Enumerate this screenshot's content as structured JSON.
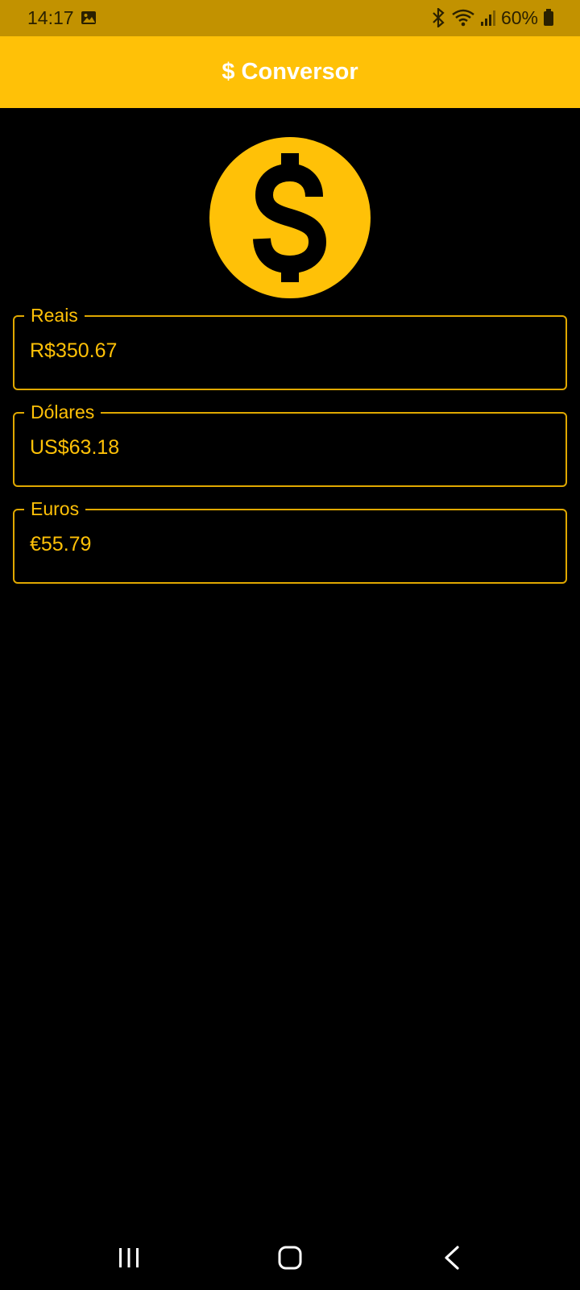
{
  "status_bar": {
    "time": "14:17",
    "battery_text": "60%",
    "icons": [
      "gallery-icon",
      "bluetooth-icon",
      "wifi-icon",
      "signal-icon",
      "battery-icon"
    ]
  },
  "app_bar": {
    "title": "$ Conversor",
    "background_color": "#ffc107"
  },
  "hero": {
    "icon": "dollar-coin-icon",
    "color": "#ffc107"
  },
  "fields": [
    {
      "label": "Reais",
      "value": "R$350.67"
    },
    {
      "label": "Dólares",
      "value": "US$63.18"
    },
    {
      "label": "Euros",
      "value": "€55.79"
    }
  ],
  "navigation": {
    "icons": [
      "recent-apps-icon",
      "home-icon",
      "back-icon"
    ]
  },
  "colors": {
    "accent": "#ffc107",
    "status_bar": "#c29200",
    "background": "#000000"
  }
}
